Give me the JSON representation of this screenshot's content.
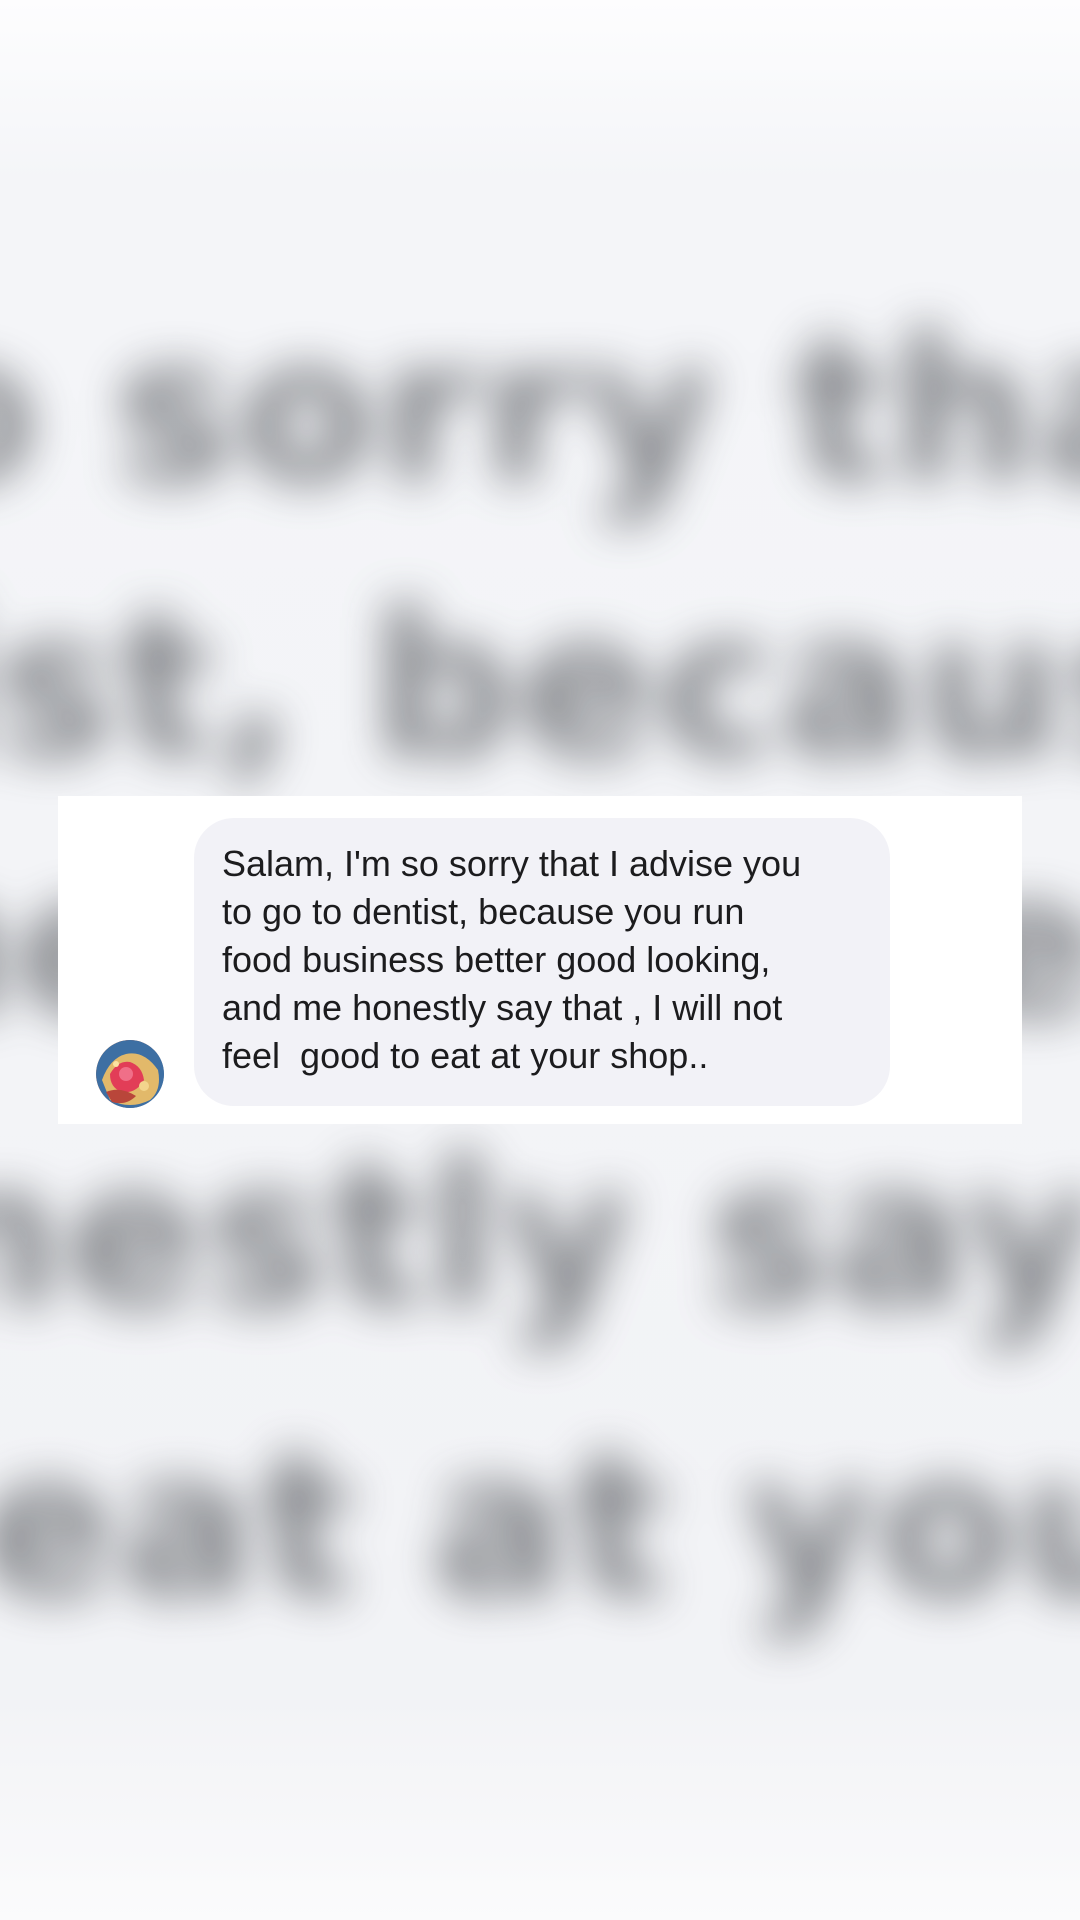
{
  "background": {
    "blurred_text_lines": [
      "o sorry that",
      "list, becaus",
      "ness better",
      "nestly say tha",
      "eat at your"
    ]
  },
  "message": {
    "text": "Salam, I'm so sorry that I advise you\nto go to dentist, because you run\nfood business better good looking,\nand me honestly say that , I will not\nfeel  good to eat at your shop.."
  },
  "colors": {
    "bubble": "#f2f2f7",
    "card": "#ffffff",
    "text": "#1c1c1e"
  }
}
